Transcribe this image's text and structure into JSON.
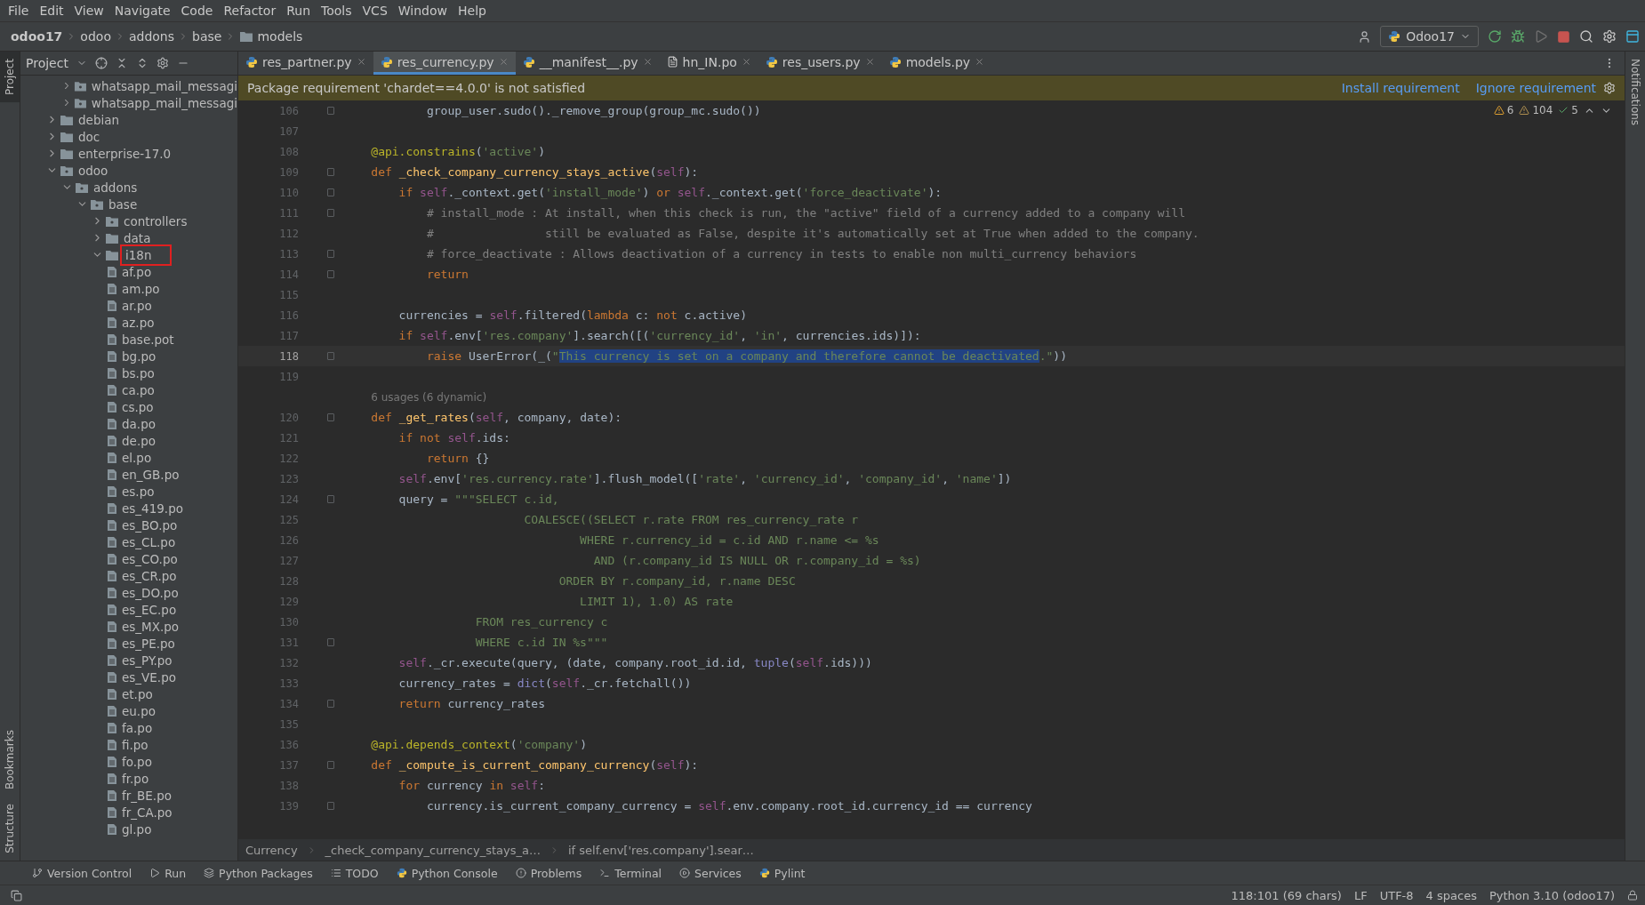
{
  "menu": [
    "File",
    "Edit",
    "View",
    "Navigate",
    "Code",
    "Refactor",
    "Run",
    "Tools",
    "VCS",
    "Window",
    "Help"
  ],
  "nav_breadcrumb": [
    {
      "label": "odoo17",
      "kind": "project"
    },
    {
      "label": "odoo",
      "kind": "plain"
    },
    {
      "label": "addons",
      "kind": "plain"
    },
    {
      "label": "base",
      "kind": "plain"
    },
    {
      "label": "models",
      "kind": "folder"
    }
  ],
  "run_config": "Odoo17",
  "side_stripe_left": [
    {
      "label": "Project",
      "selected": true
    },
    {
      "label": "Bookmarks",
      "selected": false
    },
    {
      "label": "Structure",
      "selected": false
    }
  ],
  "side_stripe_right": [
    {
      "label": "Notifications",
      "selected": false
    }
  ],
  "project_panel": {
    "title": "Project",
    "clipped_children": [
      {
        "label": "whatsapp_mail_messagi",
        "kind": "module",
        "expanded": false,
        "boxed": false
      },
      {
        "label": "whatsapp_mail_messagi",
        "kind": "module",
        "expanded": false,
        "boxed": false
      }
    ],
    "items": [
      {
        "label": "debian",
        "kind": "folder",
        "expanded": false,
        "boxed": false
      },
      {
        "label": "doc",
        "kind": "folder",
        "expanded": false,
        "boxed": false
      },
      {
        "label": "enterprise-17.0",
        "kind": "folder",
        "expanded": false,
        "boxed": false
      },
      {
        "label": "odoo",
        "kind": "module",
        "expanded": true,
        "boxed": false,
        "children": [
          {
            "label": "addons",
            "kind": "module",
            "expanded": true,
            "boxed": false,
            "children": [
              {
                "label": "base",
                "kind": "module",
                "expanded": true,
                "boxed": false,
                "children": [
                  {
                    "label": "controllers",
                    "kind": "module",
                    "expanded": false,
                    "boxed": false
                  },
                  {
                    "label": "data",
                    "kind": "folder",
                    "expanded": false,
                    "boxed": false
                  },
                  {
                    "label": "i18n",
                    "kind": "folder",
                    "expanded": true,
                    "boxed": true,
                    "children": [
                      {
                        "label": "af.po",
                        "kind": "file"
                      },
                      {
                        "label": "am.po",
                        "kind": "file"
                      },
                      {
                        "label": "ar.po",
                        "kind": "file"
                      },
                      {
                        "label": "az.po",
                        "kind": "file"
                      },
                      {
                        "label": "base.pot",
                        "kind": "file"
                      },
                      {
                        "label": "bg.po",
                        "kind": "file"
                      },
                      {
                        "label": "bs.po",
                        "kind": "file"
                      },
                      {
                        "label": "ca.po",
                        "kind": "file"
                      },
                      {
                        "label": "cs.po",
                        "kind": "file"
                      },
                      {
                        "label": "da.po",
                        "kind": "file"
                      },
                      {
                        "label": "de.po",
                        "kind": "file"
                      },
                      {
                        "label": "el.po",
                        "kind": "file"
                      },
                      {
                        "label": "en_GB.po",
                        "kind": "file"
                      },
                      {
                        "label": "es.po",
                        "kind": "file"
                      },
                      {
                        "label": "es_419.po",
                        "kind": "file"
                      },
                      {
                        "label": "es_BO.po",
                        "kind": "file"
                      },
                      {
                        "label": "es_CL.po",
                        "kind": "file"
                      },
                      {
                        "label": "es_CO.po",
                        "kind": "file"
                      },
                      {
                        "label": "es_CR.po",
                        "kind": "file"
                      },
                      {
                        "label": "es_DO.po",
                        "kind": "file"
                      },
                      {
                        "label": "es_EC.po",
                        "kind": "file"
                      },
                      {
                        "label": "es_MX.po",
                        "kind": "file"
                      },
                      {
                        "label": "es_PE.po",
                        "kind": "file"
                      },
                      {
                        "label": "es_PY.po",
                        "kind": "file"
                      },
                      {
                        "label": "es_VE.po",
                        "kind": "file"
                      },
                      {
                        "label": "et.po",
                        "kind": "file"
                      },
                      {
                        "label": "eu.po",
                        "kind": "file"
                      },
                      {
                        "label": "fa.po",
                        "kind": "file"
                      },
                      {
                        "label": "fi.po",
                        "kind": "file"
                      },
                      {
                        "label": "fo.po",
                        "kind": "file"
                      },
                      {
                        "label": "fr.po",
                        "kind": "file"
                      },
                      {
                        "label": "fr_BE.po",
                        "kind": "file"
                      },
                      {
                        "label": "fr_CA.po",
                        "kind": "file"
                      },
                      {
                        "label": "gl.po",
                        "kind": "file"
                      }
                    ]
                  }
                ]
              }
            ]
          }
        ]
      }
    ]
  },
  "tabs": [
    {
      "label": "res_partner.py",
      "kind": "python",
      "selected": false
    },
    {
      "label": "res_currency.py",
      "kind": "python",
      "selected": true
    },
    {
      "label": "__manifest__.py",
      "kind": "python",
      "selected": false
    },
    {
      "label": "hn_IN.po",
      "kind": "po",
      "selected": false
    },
    {
      "label": "res_users.py",
      "kind": "python",
      "selected": false
    },
    {
      "label": "models.py",
      "kind": "python",
      "selected": false
    }
  ],
  "banner": {
    "message": "Package requirement 'chardet==4.0.0' is not satisfied",
    "actions": [
      "Install requirement",
      "Ignore requirement"
    ]
  },
  "inspections": {
    "warnings": "6",
    "weak_warnings": "104",
    "typos": "5"
  },
  "code_lines": [
    {
      "kind": "code",
      "number": "106",
      "current": false,
      "fold_marker": true,
      "tokens": [
        {
          "kind": "plain",
          "text": "            group_user.sudo()._remove_group(group_mc.sudo())"
        }
      ]
    },
    {
      "kind": "code",
      "number": "107",
      "current": false,
      "fold_marker": false
    },
    {
      "kind": "code",
      "number": "108",
      "current": false,
      "fold_marker": false,
      "tokens": [
        {
          "kind": "deco",
          "text": "    @api.constrains"
        },
        {
          "kind": "plain",
          "text": "("
        },
        {
          "kind": "str",
          "text": "'active'"
        },
        {
          "kind": "plain",
          "text": ")"
        }
      ]
    },
    {
      "kind": "code",
      "number": "109",
      "current": false,
      "fold_marker": true,
      "tokens": [
        {
          "kind": "kw",
          "text": "    def "
        },
        {
          "kind": "fn",
          "text": "_check_company_currency_stays_active"
        },
        {
          "kind": "plain",
          "text": "("
        },
        {
          "kind": "self",
          "text": "self"
        },
        {
          "kind": "plain",
          "text": "):"
        }
      ]
    },
    {
      "kind": "code",
      "number": "110",
      "current": false,
      "fold_marker": true,
      "tokens": [
        {
          "kind": "kw",
          "text": "        if "
        },
        {
          "kind": "self",
          "text": "self"
        },
        {
          "kind": "plain",
          "text": "._context.get("
        },
        {
          "kind": "str",
          "text": "'install_mode'"
        },
        {
          "kind": "plain",
          "text": ") "
        },
        {
          "kind": "kw",
          "text": "or "
        },
        {
          "kind": "self",
          "text": "self"
        },
        {
          "kind": "plain",
          "text": "._context.get("
        },
        {
          "kind": "str",
          "text": "'force_deactivate'"
        },
        {
          "kind": "plain",
          "text": "):"
        }
      ]
    },
    {
      "kind": "code",
      "number": "111",
      "current": false,
      "fold_marker": true,
      "tokens": [
        {
          "kind": "comment",
          "text": "            # install_mode : At install, when this check is run, the \"active\" field of a currency added to a company will"
        }
      ]
    },
    {
      "kind": "code",
      "number": "112",
      "current": false,
      "fold_marker": false,
      "tokens": [
        {
          "kind": "comment",
          "text": "            #                still be evaluated as False, despite it's automatically set at True when added to the company."
        }
      ]
    },
    {
      "kind": "code",
      "number": "113",
      "current": false,
      "fold_marker": true,
      "tokens": [
        {
          "kind": "comment",
          "text": "            # force_deactivate : Allows deactivation of a currency in tests to enable non multi_currency behaviors"
        }
      ]
    },
    {
      "kind": "code",
      "number": "114",
      "current": false,
      "fold_marker": true,
      "tokens": [
        {
          "kind": "kw",
          "text": "            return"
        }
      ]
    },
    {
      "kind": "code",
      "number": "115",
      "current": false,
      "fold_marker": false
    },
    {
      "kind": "code",
      "number": "116",
      "current": false,
      "fold_marker": false,
      "tokens": [
        {
          "kind": "plain",
          "text": "        currencies = "
        },
        {
          "kind": "self",
          "text": "self"
        },
        {
          "kind": "plain",
          "text": ".filtered("
        },
        {
          "kind": "kw",
          "text": "lambda "
        },
        {
          "kind": "plain",
          "text": "c: "
        },
        {
          "kind": "kw",
          "text": "not "
        },
        {
          "kind": "plain",
          "text": "c.active)"
        }
      ]
    },
    {
      "kind": "code",
      "number": "117",
      "current": false,
      "fold_marker": false,
      "tokens": [
        {
          "kind": "kw",
          "text": "        if "
        },
        {
          "kind": "self",
          "text": "self"
        },
        {
          "kind": "plain",
          "text": ".env["
        },
        {
          "kind": "str",
          "text": "'res.company'"
        },
        {
          "kind": "plain",
          "text": "].search([("
        },
        {
          "kind": "str",
          "text": "'currency_id'"
        },
        {
          "kind": "plain",
          "text": ", "
        },
        {
          "kind": "str",
          "text": "'in'"
        },
        {
          "kind": "plain",
          "text": ", currencies.ids)]):"
        }
      ]
    },
    {
      "kind": "code",
      "number": "118",
      "current": true,
      "fold_marker": true,
      "tokens": [
        {
          "kind": "kw",
          "text": "            raise "
        },
        {
          "kind": "plain",
          "text": "UserError(_("
        },
        {
          "kind": "str",
          "text": "\""
        },
        {
          "kind": "selected",
          "text": "This currency is set on a company and therefore cannot be deactivated"
        },
        {
          "kind": "str",
          "text": ".\""
        },
        {
          "kind": "plain",
          "text": "))"
        }
      ]
    },
    {
      "kind": "code",
      "number": "119",
      "current": false,
      "fold_marker": false
    },
    {
      "kind": "hint",
      "text": "6 usages (6 dynamic)"
    },
    {
      "kind": "code",
      "number": "120",
      "current": false,
      "fold_marker": true,
      "tokens": [
        {
          "kind": "kw",
          "text": "    def "
        },
        {
          "kind": "fn",
          "text": "_get_rates"
        },
        {
          "kind": "plain",
          "text": "("
        },
        {
          "kind": "self",
          "text": "self"
        },
        {
          "kind": "plain",
          "text": ", company, date):"
        }
      ]
    },
    {
      "kind": "code",
      "number": "121",
      "current": false,
      "fold_marker": false,
      "tokens": [
        {
          "kind": "kw",
          "text": "        if not "
        },
        {
          "kind": "self",
          "text": "self"
        },
        {
          "kind": "plain",
          "text": ".ids:"
        }
      ]
    },
    {
      "kind": "code",
      "number": "122",
      "current": false,
      "fold_marker": false,
      "tokens": [
        {
          "kind": "kw",
          "text": "            return "
        },
        {
          "kind": "plain",
          "text": "{}"
        }
      ]
    },
    {
      "kind": "code",
      "number": "123",
      "current": false,
      "fold_marker": false,
      "tokens": [
        {
          "kind": "self",
          "text": "        self"
        },
        {
          "kind": "plain",
          "text": ".env["
        },
        {
          "kind": "str",
          "text": "'res.currency.rate'"
        },
        {
          "kind": "plain",
          "text": "].flush_model(["
        },
        {
          "kind": "str",
          "text": "'rate'"
        },
        {
          "kind": "plain",
          "text": ", "
        },
        {
          "kind": "str",
          "text": "'currency_id'"
        },
        {
          "kind": "plain",
          "text": ", "
        },
        {
          "kind": "str",
          "text": "'company_id'"
        },
        {
          "kind": "plain",
          "text": ", "
        },
        {
          "kind": "str",
          "text": "'name'"
        },
        {
          "kind": "plain",
          "text": "])"
        }
      ]
    },
    {
      "kind": "code",
      "number": "124",
      "current": false,
      "fold_marker": true,
      "tokens": [
        {
          "kind": "plain",
          "text": "        query = "
        },
        {
          "kind": "str",
          "text": "\"\"\"SELECT c.id,"
        }
      ]
    },
    {
      "kind": "code",
      "number": "125",
      "current": false,
      "fold_marker": false,
      "tokens": [
        {
          "kind": "str",
          "text": "                          COALESCE((SELECT r.rate FROM res_currency_rate r"
        }
      ]
    },
    {
      "kind": "code",
      "number": "126",
      "current": false,
      "fold_marker": false,
      "tokens": [
        {
          "kind": "str",
          "text": "                                  WHERE r.currency_id = c.id AND r.name <= %s"
        }
      ]
    },
    {
      "kind": "code",
      "number": "127",
      "current": false,
      "fold_marker": false,
      "tokens": [
        {
          "kind": "str",
          "text": "                                    AND (r.company_id IS NULL OR r.company_id = %s)"
        }
      ]
    },
    {
      "kind": "code",
      "number": "128",
      "current": false,
      "fold_marker": false,
      "tokens": [
        {
          "kind": "str",
          "text": "                               ORDER BY r.company_id, r.name DESC"
        }
      ]
    },
    {
      "kind": "code",
      "number": "129",
      "current": false,
      "fold_marker": false,
      "tokens": [
        {
          "kind": "str",
          "text": "                                  LIMIT 1), 1.0) AS rate"
        }
      ]
    },
    {
      "kind": "code",
      "number": "130",
      "current": false,
      "fold_marker": false,
      "tokens": [
        {
          "kind": "str",
          "text": "                   FROM res_currency c"
        }
      ]
    },
    {
      "kind": "code",
      "number": "131",
      "current": false,
      "fold_marker": true,
      "tokens": [
        {
          "kind": "str",
          "text": "                   WHERE c.id IN %s\"\"\""
        }
      ]
    },
    {
      "kind": "code",
      "number": "132",
      "current": false,
      "fold_marker": false,
      "tokens": [
        {
          "kind": "self",
          "text": "        self"
        },
        {
          "kind": "plain",
          "text": "._cr.execute(query, (date, company.root_id.id, "
        },
        {
          "kind": "builtin",
          "text": "tuple"
        },
        {
          "kind": "plain",
          "text": "("
        },
        {
          "kind": "self",
          "text": "self"
        },
        {
          "kind": "plain",
          "text": ".ids)))"
        }
      ]
    },
    {
      "kind": "code",
      "number": "133",
      "current": false,
      "fold_marker": false,
      "tokens": [
        {
          "kind": "plain",
          "text": "        currency_rates = "
        },
        {
          "kind": "builtin",
          "text": "dict"
        },
        {
          "kind": "plain",
          "text": "("
        },
        {
          "kind": "self",
          "text": "self"
        },
        {
          "kind": "plain",
          "text": "._cr.fetchall())"
        }
      ]
    },
    {
      "kind": "code",
      "number": "134",
      "current": false,
      "fold_marker": true,
      "tokens": [
        {
          "kind": "kw",
          "text": "        return "
        },
        {
          "kind": "plain",
          "text": "currency_rates"
        }
      ]
    },
    {
      "kind": "code",
      "number": "135",
      "current": false,
      "fold_marker": false
    },
    {
      "kind": "code",
      "number": "136",
      "current": false,
      "fold_marker": false,
      "tokens": [
        {
          "kind": "deco",
          "text": "    @api.depends_context"
        },
        {
          "kind": "plain",
          "text": "("
        },
        {
          "kind": "str",
          "text": "'company'"
        },
        {
          "kind": "plain",
          "text": ")"
        }
      ]
    },
    {
      "kind": "code",
      "number": "137",
      "current": false,
      "fold_marker": true,
      "tokens": [
        {
          "kind": "kw",
          "text": "    def "
        },
        {
          "kind": "fn",
          "text": "_compute_is_current_company_currency"
        },
        {
          "kind": "plain",
          "text": "("
        },
        {
          "kind": "self",
          "text": "self"
        },
        {
          "kind": "plain",
          "text": "):"
        }
      ]
    },
    {
      "kind": "code",
      "number": "138",
      "current": false,
      "fold_marker": false,
      "tokens": [
        {
          "kind": "kw",
          "text": "        for "
        },
        {
          "kind": "plain",
          "text": "currency "
        },
        {
          "kind": "kw",
          "text": "in "
        },
        {
          "kind": "self",
          "text": "self"
        },
        {
          "kind": "plain",
          "text": ":"
        }
      ]
    },
    {
      "kind": "code",
      "number": "139",
      "current": false,
      "fold_marker": true,
      "tokens": [
        {
          "kind": "plain",
          "text": "            currency.is_current_company_currency = "
        },
        {
          "kind": "self",
          "text": "self"
        },
        {
          "kind": "plain",
          "text": ".env.company.root_id.currency_id == currency"
        }
      ]
    }
  ],
  "editor_breadcrumb": [
    "Currency",
    "_check_company_currency_stays_a…",
    "if self.env['res.company'].sear…"
  ],
  "tool_windows": [
    {
      "label": "Version Control",
      "kind": "vcs"
    },
    {
      "label": "Run",
      "kind": "run"
    },
    {
      "label": "Python Packages",
      "kind": "packages"
    },
    {
      "label": "TODO",
      "kind": "todo"
    },
    {
      "label": "Python Console",
      "kind": "console"
    },
    {
      "label": "Problems",
      "kind": "problems"
    },
    {
      "label": "Terminal",
      "kind": "terminal"
    },
    {
      "label": "Services",
      "kind": "services"
    },
    {
      "label": "Pylint",
      "kind": "pylint"
    }
  ],
  "status_bar": [
    "118:101 (69 chars)",
    "LF",
    "UTF-8",
    "4 spaces",
    "Python 3.10 (odoo17)"
  ]
}
